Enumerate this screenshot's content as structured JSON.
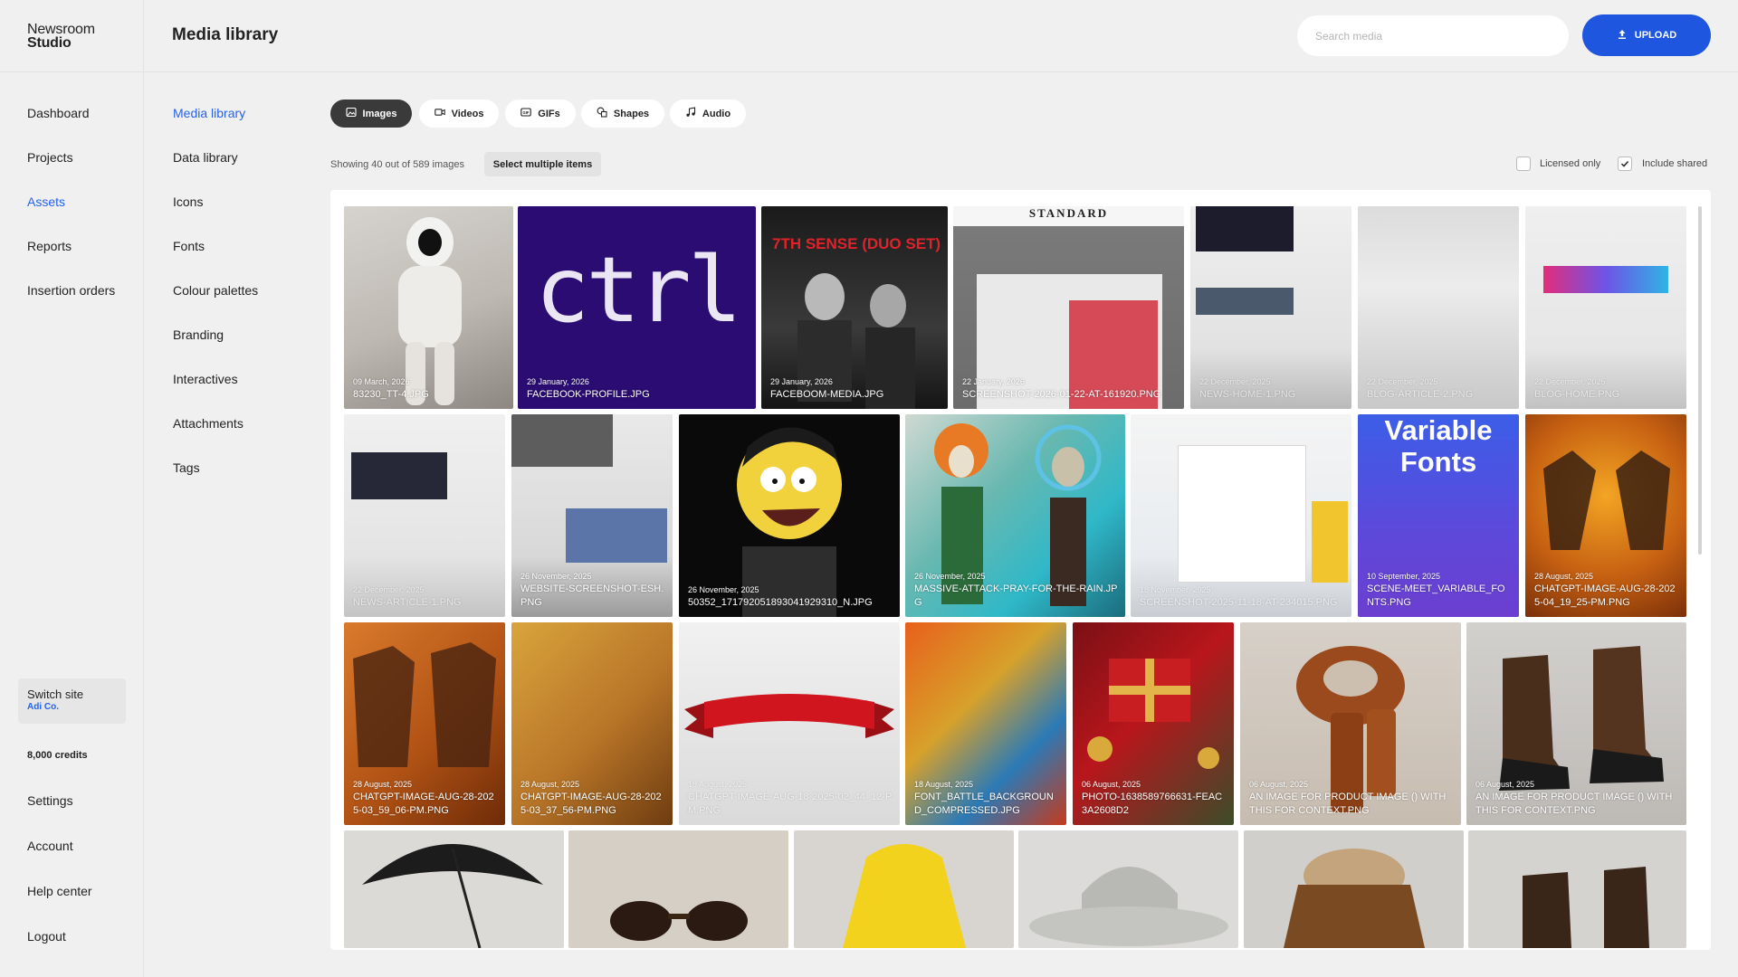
{
  "logo": {
    "line1": "Newsroom",
    "line2": "Studio"
  },
  "main_nav": [
    {
      "label": "Dashboard"
    },
    {
      "label": "Projects"
    },
    {
      "label": "Assets"
    },
    {
      "label": "Reports"
    },
    {
      "label": "Insertion orders"
    }
  ],
  "switch_site": {
    "label": "Switch site",
    "site": "Adi Co."
  },
  "credits": "8,000 credits",
  "bottom_nav": [
    {
      "label": "Settings"
    },
    {
      "label": "Account"
    },
    {
      "label": "Help center"
    },
    {
      "label": "Logout"
    }
  ],
  "header": {
    "title": "Media library",
    "search_placeholder": "Search media",
    "upload_label": "UPLOAD"
  },
  "sub_nav": [
    {
      "label": "Media library"
    },
    {
      "label": "Data library"
    },
    {
      "label": "Icons"
    },
    {
      "label": "Fonts"
    },
    {
      "label": "Colour palettes"
    },
    {
      "label": "Branding"
    },
    {
      "label": "Interactives"
    },
    {
      "label": "Attachments"
    },
    {
      "label": "Tags"
    }
  ],
  "tabs": [
    {
      "label": "Images",
      "icon": "image-icon"
    },
    {
      "label": "Videos",
      "icon": "video-icon"
    },
    {
      "label": "GIFs",
      "icon": "gif-icon"
    },
    {
      "label": "Shapes",
      "icon": "shapes-icon"
    },
    {
      "label": "Audio",
      "icon": "music-icon"
    }
  ],
  "toolbar": {
    "showing": "Showing 40 out of 589 images",
    "select_multiple": "Select multiple items",
    "licensed_only": "Licensed only",
    "include_shared": "Include shared"
  },
  "tiles": [
    {
      "date": "09 March, 2026",
      "name": "83230_TT-4.JPG"
    },
    {
      "date": "29 January, 2026",
      "name": "FACEBOOK-PROFILE.JPG",
      "text": "ctrl"
    },
    {
      "date": "29 January, 2026",
      "name": "FACEBOOM-MEDIA.JPG",
      "text": "7TH SENSE (DUO SET)"
    },
    {
      "date": "22 January, 2026",
      "name": "SCREENSHOT-2026-01-22-AT-161920.PNG",
      "text": "STANDARD"
    },
    {
      "date": "22 December, 2025",
      "name": "NEWS-HOME-1.PNG"
    },
    {
      "date": "22 December, 2025",
      "name": "BLOG-ARTICLE-2.PNG"
    },
    {
      "date": "22 December, 2025",
      "name": "BLOG-HOME.PNG"
    },
    {
      "date": "22 December, 2025",
      "name": "NEWS-ARTICLE-1.PNG"
    },
    {
      "date": "26 November, 2025",
      "name": "WEBSITE-SCREENSHOT-ESH.PNG"
    },
    {
      "date": "26 November, 2025",
      "name": "50352_171792051893041929310_N.JPG"
    },
    {
      "date": "26 November, 2025",
      "name": "MASSIVE-ATTACK-PRAY-FOR-THE-RAIN.JPG"
    },
    {
      "date": "18 November, 2025",
      "name": "SCREENSHOT-2025-11-18-AT-234015.PNG"
    },
    {
      "date": "10 September, 2025",
      "name": "SCENE-MEET_VARIABLE_FONTS.PNG",
      "text": "Variable Fonts"
    },
    {
      "date": "28 August, 2025",
      "name": "CHATGPT-IMAGE-AUG-28-2025-04_19_25-PM.PNG"
    },
    {
      "date": "28 August, 2025",
      "name": "CHATGPT-IMAGE-AUG-28-2025-03_59_06-PM.PNG"
    },
    {
      "date": "28 August, 2025",
      "name": "CHATGPT-IMAGE-AUG-28-2025-03_37_56-PM.PNG"
    },
    {
      "date": "18 August, 2025",
      "name": "CHATGPT-IMAGE-AUG-18-2025-02_44_12-PM.PNG"
    },
    {
      "date": "18 August, 2025",
      "name": "FONT_BATTLE_BACKGROUND_COMPRESSED.JPG"
    },
    {
      "date": "06 August, 2025",
      "name": "PHOTO-1638589766631-FEAC3A2608D2"
    },
    {
      "date": "06 August, 2025",
      "name": "AN IMAGE FOR PRODUCT IMAGE () WITH THIS FOR CONTEXT.PNG"
    },
    {
      "date": "06 August, 2025",
      "name": "AN IMAGE FOR PRODUCT IMAGE () WITH THIS FOR CONTEXT.PNG"
    },
    {
      "date": "",
      "name": ""
    },
    {
      "date": "",
      "name": ""
    },
    {
      "date": "",
      "name": ""
    },
    {
      "date": "",
      "name": ""
    },
    {
      "date": "",
      "name": ""
    },
    {
      "date": "",
      "name": ""
    }
  ],
  "colors": {
    "accent": "#1e56e0",
    "active_link": "#2563eb",
    "active_tab": "#3a3a3a"
  }
}
